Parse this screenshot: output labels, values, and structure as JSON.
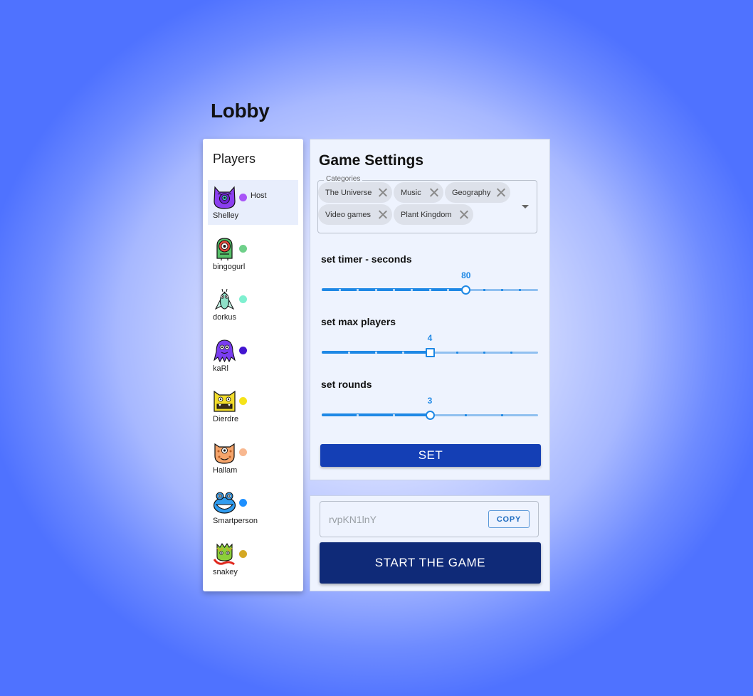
{
  "page_title": "Lobby",
  "players": {
    "header": "Players",
    "host_label": "Host",
    "list": [
      {
        "name": "Shelley",
        "dot_color": "#a855f7",
        "avatar": "purple-cat-monster-icon",
        "avatar_color": "#8b3ff0",
        "is_host": true
      },
      {
        "name": "bingogurl",
        "dot_color": "#6fd08a",
        "avatar": "one-eyed-green-monster-icon",
        "avatar_color": "#58c06a",
        "is_host": false
      },
      {
        "name": "dorkus",
        "dot_color": "#7ff0d0",
        "avatar": "teal-fly-monster-icon",
        "avatar_color": "#8fe0c8",
        "is_host": false
      },
      {
        "name": "kaRl",
        "dot_color": "#4315d0",
        "avatar": "purple-octopus-monster-icon",
        "avatar_color": "#7a3df0",
        "is_host": false
      },
      {
        "name": "Dierdre",
        "dot_color": "#f5e31a",
        "avatar": "yellow-fanged-monster-icon",
        "avatar_color": "#f2dc2a",
        "is_host": false
      },
      {
        "name": "Hallam",
        "dot_color": "#f8b890",
        "avatar": "orange-spotted-monster-icon",
        "avatar_color": "#f5a46a",
        "is_host": false
      },
      {
        "name": "Smartperson",
        "dot_color": "#1e90ff",
        "avatar": "blue-frog-monster-icon",
        "avatar_color": "#2f9cf0",
        "is_host": false
      },
      {
        "name": "snakey",
        "dot_color": "#d4a824",
        "avatar": "green-snake-monster-icon",
        "avatar_color": "#8ccf3a",
        "is_host": false
      }
    ]
  },
  "settings": {
    "title": "Game Settings",
    "categories_label": "Categories",
    "categories": [
      "The Universe",
      "Music",
      "Geography",
      "Video games",
      "Plant Kingdom"
    ],
    "timer": {
      "label": "set timer - seconds",
      "value": "80",
      "fraction": 0.667
    },
    "max_players": {
      "label": "set max players",
      "value": "4",
      "fraction": 0.5
    },
    "rounds": {
      "label": "set rounds",
      "value": "3",
      "fraction": 0.5
    },
    "set_button": "SET"
  },
  "invite": {
    "code": "rvpKN1lnY",
    "copy_button": "COPY",
    "start_button": "START THE GAME"
  },
  "colors": {
    "accent": "#1e88e5",
    "set_button": "#143fb5",
    "start_button": "#0f2a78"
  }
}
